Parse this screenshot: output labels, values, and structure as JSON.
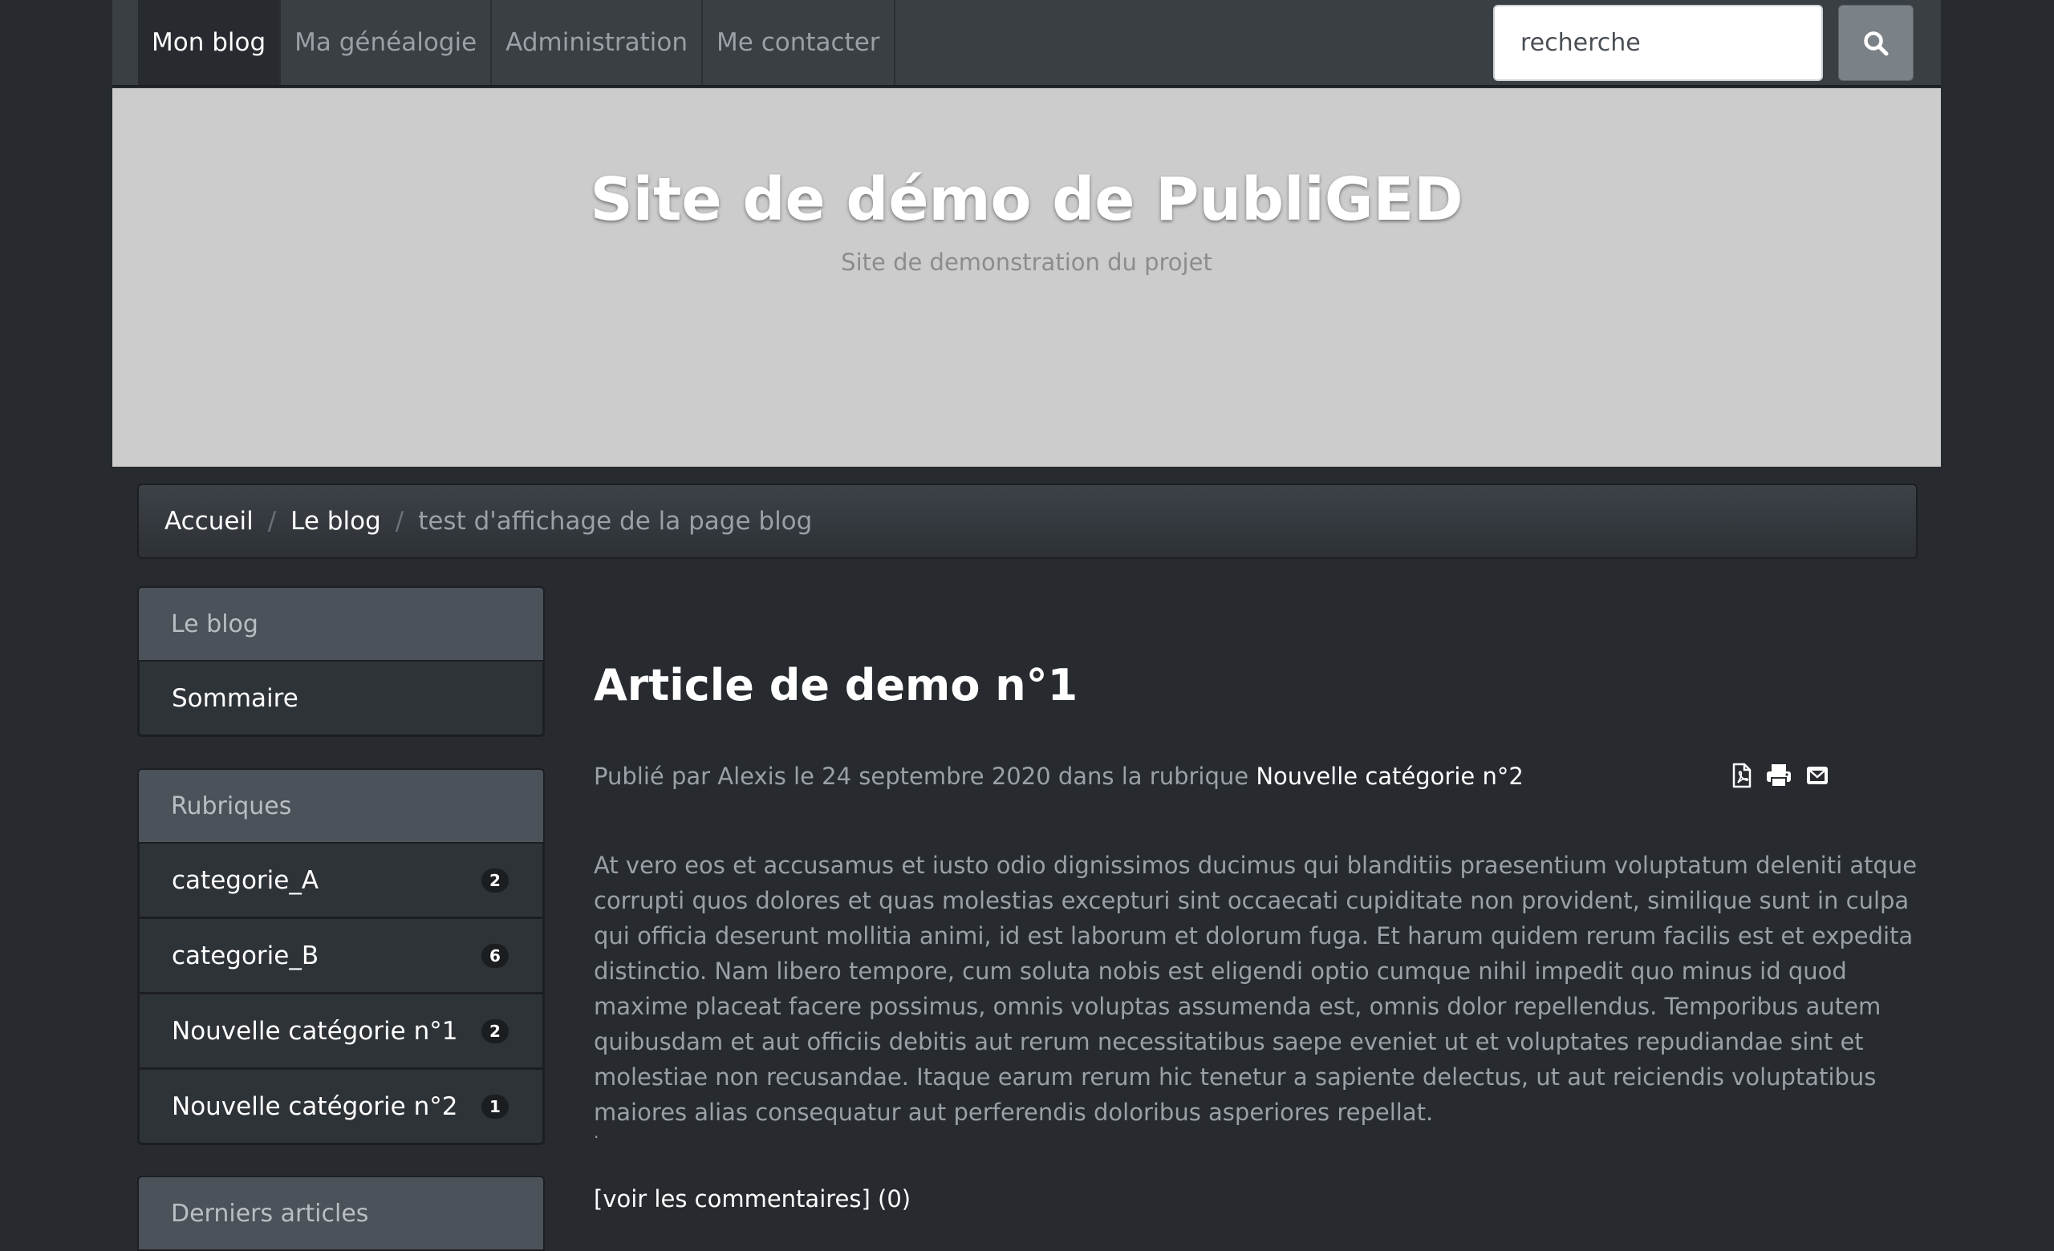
{
  "nav": {
    "items": [
      {
        "label": "Mon blog",
        "active": true
      },
      {
        "label": "Ma généalogie",
        "active": false
      },
      {
        "label": "Administration",
        "active": false
      },
      {
        "label": "Me contacter",
        "active": false
      }
    ],
    "search_placeholder": "recherche",
    "search_icon": "search-icon"
  },
  "hero": {
    "title": "Site de démo de PubliGED",
    "subtitle": "Site de demonstration du projet"
  },
  "breadcrumb": {
    "items": [
      "Accueil",
      "Le blog"
    ],
    "current": "test d'affichage de la page blog",
    "separator": "/"
  },
  "sidebar": {
    "blog": {
      "title": "Le blog",
      "items": [
        "Sommaire"
      ]
    },
    "rubriques": {
      "title": "Rubriques",
      "items": [
        {
          "label": "categorie_A",
          "count": "2"
        },
        {
          "label": "categorie_B",
          "count": "6"
        },
        {
          "label": "Nouvelle catégorie n°1",
          "count": "2"
        },
        {
          "label": "Nouvelle catégorie n°2",
          "count": "1"
        }
      ]
    },
    "recent": {
      "title": "Derniers articles"
    }
  },
  "article": {
    "title": "Article de demo n°1",
    "meta_prefix": "Publié par Alexis le 24 septembre 2020 dans la rubrique ",
    "meta_category": "Nouvelle catégorie n°2",
    "actions": [
      "pdf-icon",
      "print-icon",
      "email-icon"
    ],
    "body": "At vero eos et accusamus et iusto odio dignissimos ducimus qui blanditiis praesentium voluptatum deleniti atque corrupti quos dolores et quas molestias excepturi sint occaecati cupiditate non provident, similique sunt in culpa qui officia deserunt mollitia animi, id est laborum et dolorum fuga. Et harum quidem rerum facilis est et expedita distinctio. Nam libero tempore, cum soluta nobis est eligendi optio cumque nihil impedit quo minus id quod maxime placeat facere possimus, omnis voluptas assumenda est, omnis dolor repellendus. Temporibus autem quibusdam et aut officiis debitis aut rerum necessitatibus saepe eveniet ut et voluptates repudiandae sint et molestiae non recusandae. Itaque earum rerum hic tenetur a sapiente delectus, ut aut reiciendis voluptatibus maiores alias consequatur aut perferendis doloribus asperiores repellat.",
    "trailing_dot": ".",
    "comments_link": "[voir les commentaires]",
    "comments_count": " (0)"
  },
  "colors": {
    "background": "#272b30",
    "navbar": "#3a3f44",
    "hero": "#cccccc",
    "panel_header": "#4b5259",
    "panel_item": "#2e3338"
  }
}
